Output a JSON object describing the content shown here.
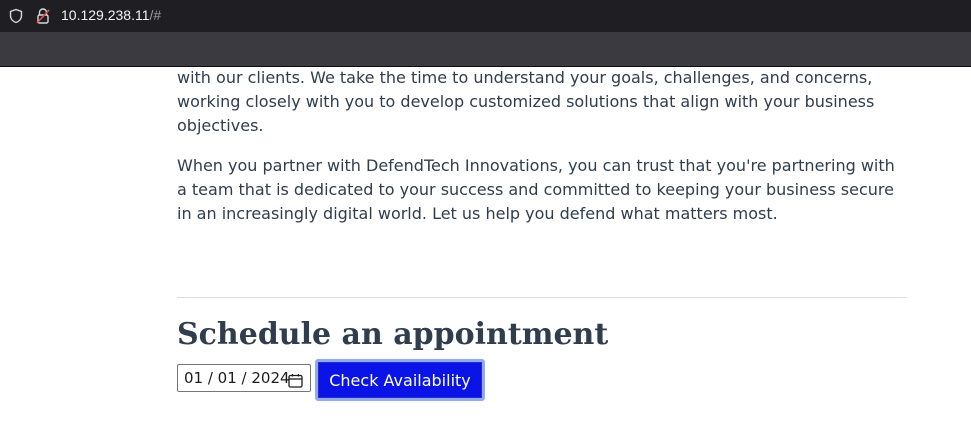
{
  "browser": {
    "url_host": "10.129.238.11",
    "url_path": "/#"
  },
  "main": {
    "paragraphs": [
      "with our clients. We take the time to understand your goals, challenges, and concerns, working closely with you to develop customized solutions that align with your business objectives.",
      "When you partner with DefendTech Innovations, you can trust that you're partnering with a team that is dedicated to your success and committed to keeping your business secure in an increasingly digital world. Let us help you defend what matters most."
    ],
    "appointment": {
      "heading": "Schedule an appointment",
      "date_value": "01 / 01 / 2024",
      "button_label": "Check Availability"
    }
  },
  "colors": {
    "button_bg": "#0a14e6",
    "text": "#2f3d4d"
  }
}
